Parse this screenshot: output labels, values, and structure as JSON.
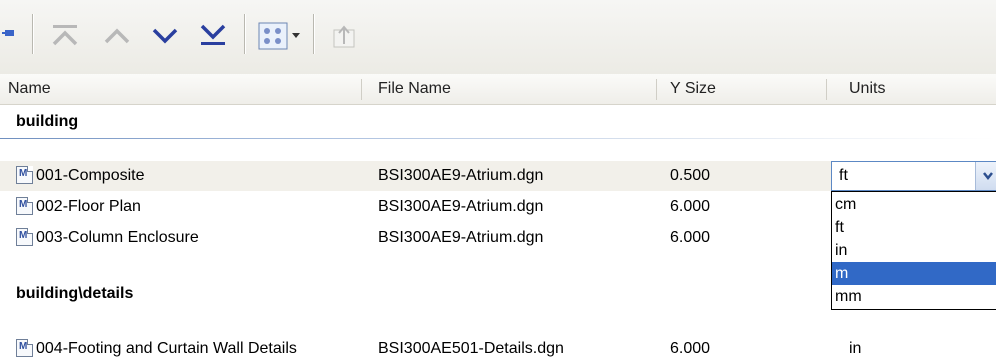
{
  "toolbar": {
    "icons": [
      "pin-icon",
      "move-top-icon",
      "move-up-icon",
      "move-down-icon",
      "move-bottom-icon",
      "view-options-icon",
      "dropdown-arrow-icon",
      "upload-icon"
    ]
  },
  "columns": {
    "name": "Name",
    "file_name": "File Name",
    "y_size": "Y Size",
    "units": "Units"
  },
  "groups": [
    {
      "label": "building",
      "rows": [
        {
          "name": "001-Composite",
          "file": "BSI300AE9-Atrium.dgn",
          "ysize": "0.500",
          "units": "ft"
        },
        {
          "name": "002-Floor Plan",
          "file": "BSI300AE9-Atrium.dgn",
          "ysize": "6.000",
          "units": ""
        },
        {
          "name": "003-Column Enclosure",
          "file": "BSI300AE9-Atrium.dgn",
          "ysize": "6.000",
          "units": ""
        }
      ]
    },
    {
      "label": "building\\details",
      "rows": [
        {
          "name": "004-Footing and Curtain Wall Details",
          "file": "BSI300AE501-Details.dgn",
          "ysize": "6.000",
          "units": "in"
        }
      ]
    }
  ],
  "units_combo": {
    "value": "ft",
    "options": [
      "cm",
      "ft",
      "in",
      "m",
      "mm"
    ],
    "highlighted": "m"
  },
  "colors": {
    "selection": "#3169c6",
    "toolbar_icon": "#2a3f9f",
    "row_highlight": "#f2f0ea"
  }
}
